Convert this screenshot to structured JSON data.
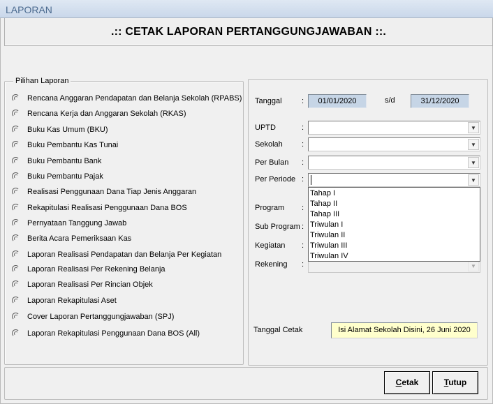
{
  "window": {
    "title": "LAPORAN"
  },
  "header": {
    "title": ".:: CETAK LAPORAN PERTANGGUNGJAWABAN ::."
  },
  "pilihan_laporan": {
    "legend": "Pilihan Laporan",
    "items": [
      "Rencana Anggaran Pendapatan dan Belanja Sekolah (RPABS)",
      "Rencana Kerja dan Anggaran Sekolah (RKAS)",
      "Buku Kas Umum (BKU)",
      "Buku Pembantu Kas Tunai",
      "Buku Pembantu Bank",
      "Buku Pembantu Pajak",
      "Realisasi Penggunaan Dana Tiap Jenis Anggaran",
      "Rekapitulasi Realisasi Penggunaan Dana BOS",
      "Pernyataan Tanggung Jawab",
      "Berita Acara Pemeriksaan Kas",
      "Laporan Realisasi Pendapatan dan Belanja Per Kegiatan",
      "Laporan Realisasi Per Rekening Belanja",
      "Laporan Realisasi Per Rincian Objek",
      "Laporan Rekapitulasi Aset",
      "Cover  Laporan Pertanggungjawaban (SPJ)",
      "Laporan Rekapitulasi Penggunaan Dana BOS (All)"
    ]
  },
  "form": {
    "tanggal_label": "Tanggal",
    "colon": ":",
    "tanggal_from": "01/01/2020",
    "sd_label": "s/d",
    "tanggal_to": "31/12/2020",
    "uptd_label": "UPTD",
    "sekolah_label": "Sekolah",
    "per_bulan_label": "Per Bulan",
    "per_periode_label": "Per Periode",
    "program_label": "Program",
    "sub_program_label": "Sub Program",
    "kegiatan_label": "Kegiatan",
    "rekening_label": "Rekening",
    "tanggal_cetak_label": "Tanggal Cetak",
    "tanggal_cetak_value": "Isi Alamat Sekolah Disini, 26 Juni 2020"
  },
  "periode_options": [
    "Tahap I",
    "Tahap II",
    "Tahap III",
    "Triwulan I",
    "Triwulan II",
    "Triwulan III",
    "Triwulan IV"
  ],
  "buttons": {
    "cetak_accel": "C",
    "cetak_rest": "etak",
    "tutup_accel": "T",
    "tutup_rest": "utup"
  },
  "icons": {
    "radio": "radio-button-icon",
    "dropdown": "chevron-down-icon"
  }
}
